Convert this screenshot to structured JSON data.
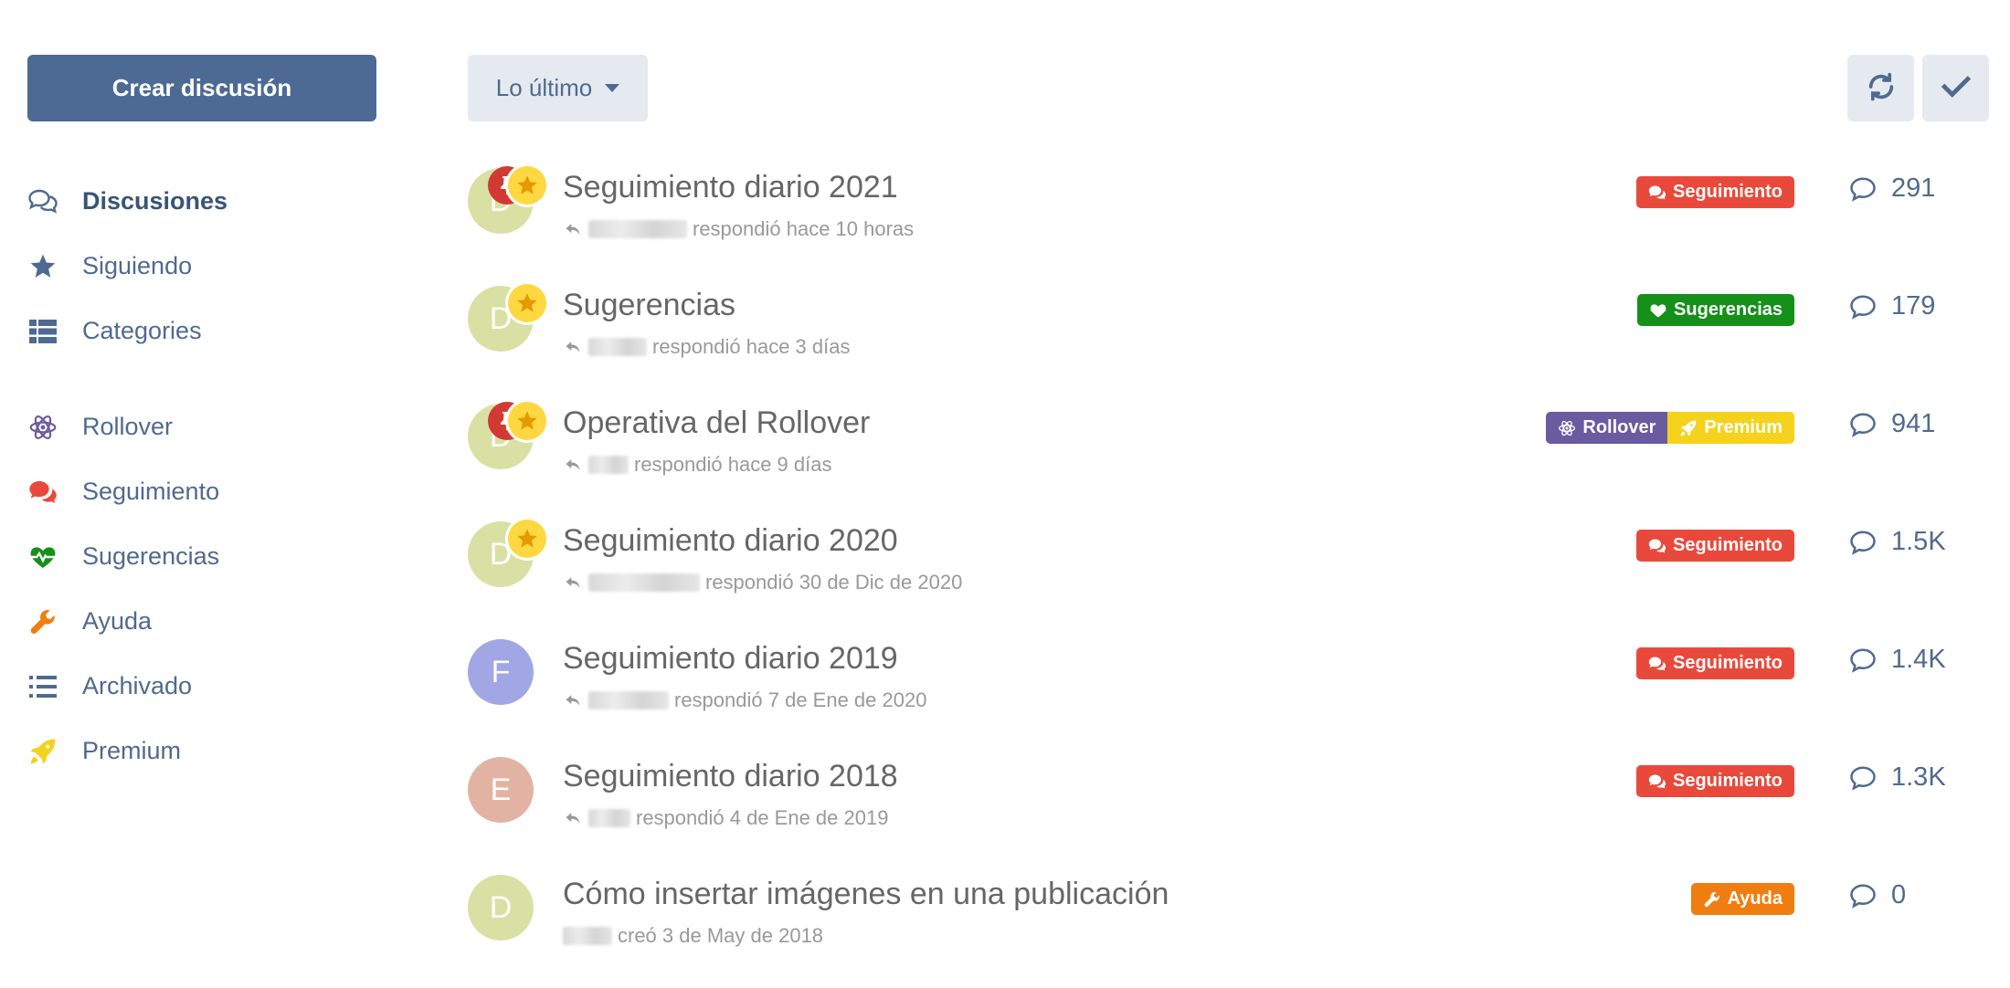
{
  "sidebar": {
    "start_button": "Crear discusión",
    "nav": [
      {
        "label": "Discusiones",
        "icon": "comments-icon",
        "active": true
      },
      {
        "label": "Siguiendo",
        "icon": "star-icon"
      },
      {
        "label": "Categories",
        "icon": "list-grid-icon"
      },
      {
        "label": "Rollover",
        "icon": "atom-icon"
      },
      {
        "label": "Seguimiento",
        "icon": "comments-solid-icon"
      },
      {
        "label": "Sugerencias",
        "icon": "heartbeat-icon"
      },
      {
        "label": "Ayuda",
        "icon": "wrench-icon"
      },
      {
        "label": "Archivado",
        "icon": "list-icon"
      },
      {
        "label": "Premium",
        "icon": "rocket-icon"
      }
    ]
  },
  "toolbar": {
    "sort_label": "Lo último",
    "refresh_icon": "refresh-icon",
    "mark_read_icon": "check-icon"
  },
  "discussions": [
    {
      "title": "Seguimiento diario 2021",
      "meta": "respondió hace 10 horas",
      "count": "291",
      "avatar": "D"
    },
    {
      "title": "Sugerencias",
      "meta": "respondió hace 3 días",
      "count": "179",
      "avatar": "D"
    },
    {
      "title": "Operativa del Rollover",
      "meta": "respondió hace 9 días",
      "count": "941",
      "avatar": "D"
    },
    {
      "title": "Seguimiento diario 2020",
      "meta": "respondió 30 de Dic de 2020",
      "count": "1.5K",
      "avatar": "D"
    },
    {
      "title": "Seguimiento diario 2019",
      "meta": "respondió 7 de Ene de 2020",
      "count": "1.4K",
      "avatar": "F"
    },
    {
      "title": "Seguimiento diario 2018",
      "meta": "respondió 4 de Ene de 2019",
      "count": "1.3K",
      "avatar": "E"
    },
    {
      "title": "Cómo insertar imágenes en una publicación",
      "meta": "creó 3 de May de 2018",
      "count": "0",
      "avatar": "D"
    }
  ],
  "tags": {
    "seguimiento": "Seguimiento",
    "sugerencias": "Sugerencias",
    "rollover": "Rollover",
    "premium": "Premium",
    "ayuda": "Ayuda"
  },
  "colors": {
    "primary": "#4d6a94",
    "seguimiento": "#e9493b",
    "sugerencias": "#159019",
    "rollover": "#6a5a9f",
    "premium": "#f5d21b",
    "ayuda": "#f07d10",
    "avatar_d": "#d9e0a3",
    "avatar_f": "#a1a6e4",
    "avatar_e": "#e2b3a3"
  }
}
